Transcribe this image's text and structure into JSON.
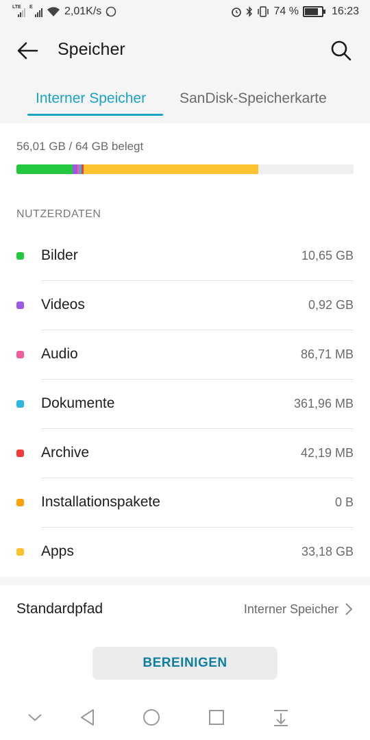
{
  "status": {
    "signal1_tag": "LTE",
    "signal2_tag": "E",
    "net_speed": "2,01K/s",
    "battery_percent": "74 %",
    "battery_level": 0.74,
    "time": "16:23"
  },
  "appbar": {
    "title": "Speicher"
  },
  "tabs": [
    {
      "label": "Interner Speicher",
      "active": true
    },
    {
      "label": "SanDisk-Speicherkarte",
      "active": false
    }
  ],
  "storage": {
    "used_text": "56,01 GB / 64 GB belegt",
    "total_gb": 64,
    "used_gb": 56.01
  },
  "section_title": "NUTZERDATEN",
  "categories": [
    {
      "label": "Bilder",
      "size": "10,65 GB",
      "color": "#22c83e"
    },
    {
      "label": "Videos",
      "size": "0,92 GB",
      "color": "#9b59e8"
    },
    {
      "label": "Audio",
      "size": "86,71 MB",
      "color": "#ef5d9b"
    },
    {
      "label": "Dokumente",
      "size": "361,96 MB",
      "color": "#2ab7e0"
    },
    {
      "label": "Archive",
      "size": "42,19 MB",
      "color": "#ee3b3b"
    },
    {
      "label": "Installationspakete",
      "size": "0 B",
      "color": "#ff9f0a"
    },
    {
      "label": "Apps",
      "size": "33,18 GB",
      "color": "#fcc22f"
    }
  ],
  "default_path": {
    "label": "Standardpfad",
    "value": "Interner Speicher"
  },
  "clean_button": "BEREINIGEN",
  "colors": {
    "accent": "#1aa2c8",
    "button_text": "#0f7fa0"
  }
}
